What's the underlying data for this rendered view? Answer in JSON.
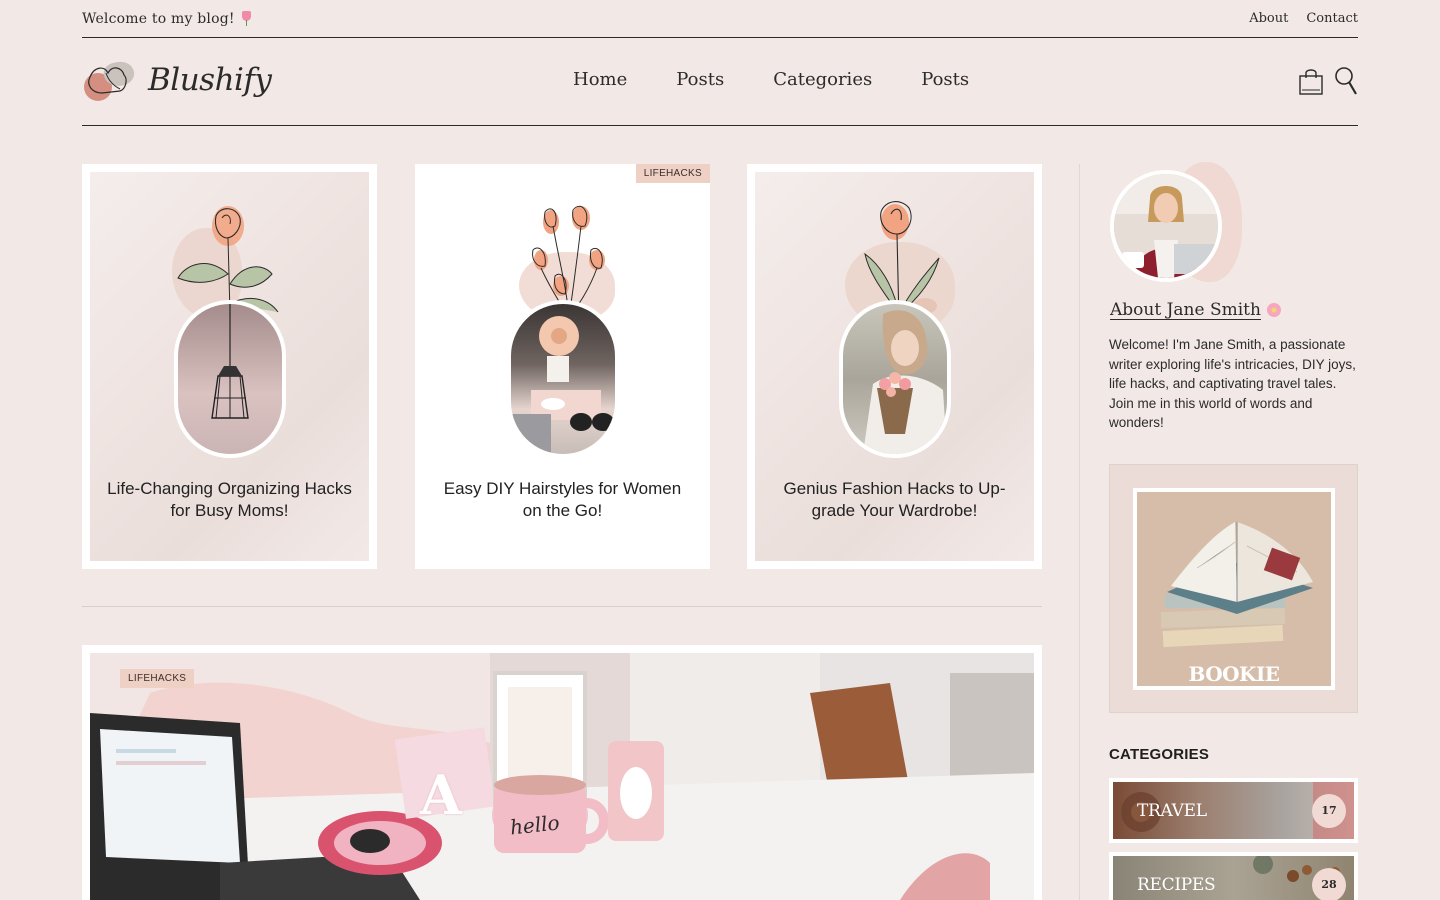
{
  "topbar": {
    "welcome": "Welcome to my blog!",
    "links": [
      "About",
      "Contact"
    ]
  },
  "header": {
    "logo_text": "Blushify",
    "nav": [
      "Home",
      "Posts",
      "Categories",
      "Posts"
    ],
    "icons": [
      "shopping-bag-icon",
      "search-icon"
    ]
  },
  "cards": [
    {
      "title": "Life-Changing Organizing Hacks for Busy Moms!",
      "tag": ""
    },
    {
      "title": "Easy DIY Hairstyles for Women on the Go!",
      "tag": "LIFEHACKS"
    },
    {
      "title": "Genius Fashion Hacks to Up-grade Your Wardrobe!",
      "tag": ""
    }
  ],
  "featured": {
    "tag": "LIFEHACKS",
    "mug_text": "hello",
    "letter": "A"
  },
  "sidebar": {
    "about_title": "About Jane Smith",
    "about_text": "Welcome! I'm Jane Smith, a passionate writer exploring life's intricacies, DIY joys, life hacks, and captivating travel tales. Join me in this world of words and wonders!",
    "ad_text": "BOOKIE",
    "categories_heading": "CATEGORIES",
    "categories": [
      {
        "label": "TRAVEL",
        "count": "17"
      },
      {
        "label": "RECIPES",
        "count": "28"
      }
    ]
  },
  "colors": {
    "background": "#f2e8e5",
    "accent": "#efd0c5",
    "text": "#2b2b2b"
  }
}
